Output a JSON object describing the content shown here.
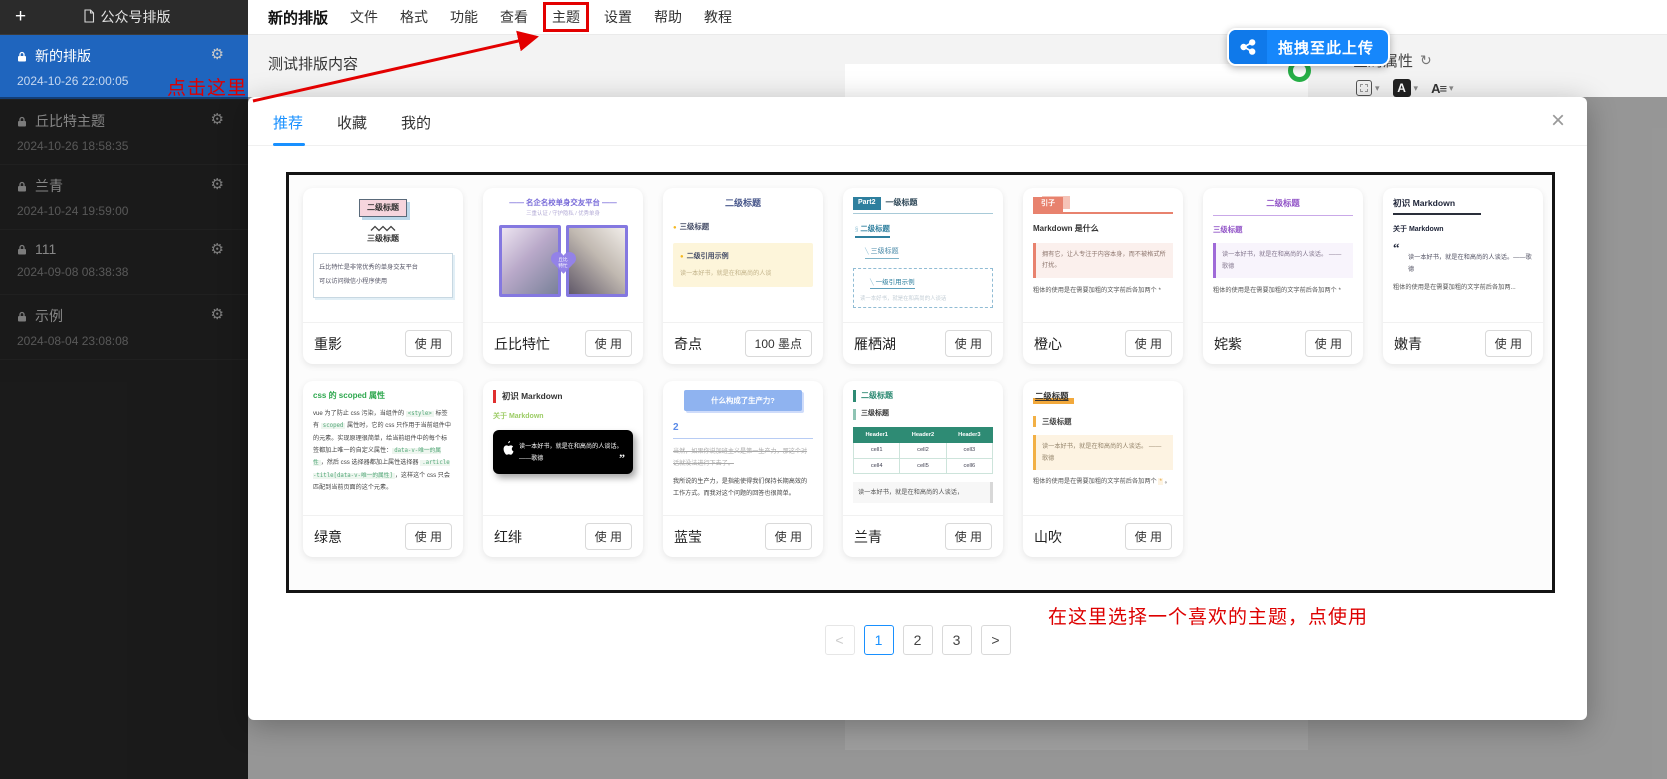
{
  "app": {
    "title": "公众号排版",
    "new_doc_button": "+",
    "accent_blue": "#1890ff",
    "sidebar_selected_blue": "#1f65be",
    "annotation_red": "#dd0000",
    "upload_blue": "#1687fb"
  },
  "sidebar": {
    "items": [
      {
        "title": "新的排版",
        "date": "2024-10-26 22:00:05",
        "selected": true
      },
      {
        "title": "丘比特主题",
        "date": "2024-10-26 18:58:35",
        "selected": false
      },
      {
        "title": "兰青",
        "date": "2024-10-24 19:59:00",
        "selected": false
      },
      {
        "title": "111",
        "date": "2024-09-08 08:38:38",
        "selected": false
      },
      {
        "title": "示例",
        "date": "2024-08-04 23:08:08",
        "selected": false
      }
    ]
  },
  "menu": {
    "items": [
      "新的排版",
      "文件",
      "格式",
      "功能",
      "查看",
      "主题",
      "设置",
      "帮助",
      "教程"
    ]
  },
  "editor": {
    "content": "测试排版内容",
    "preview_content": "测试排版内容"
  },
  "top_right": {
    "upload_label": "拖拽至此上传",
    "global_props_label": "全局属性",
    "refresh_icon": "↻",
    "font_icon_label": "A",
    "text_style_icon_label": "A≡",
    "chevron": "▾"
  },
  "annotations": {
    "click_here": "点击这里",
    "choose_theme": "在这里选择一个喜欢的主题，点使用"
  },
  "modal": {
    "tabs": [
      {
        "label": "推荐",
        "active": true
      },
      {
        "label": "收藏",
        "active": false
      },
      {
        "label": "我的",
        "active": false
      }
    ],
    "close": "×",
    "pagination": {
      "prev": "<",
      "pages": [
        "1",
        "2",
        "3"
      ],
      "next": ">",
      "active_page": "1"
    },
    "themes_row1": [
      {
        "name": "重影",
        "action": "使 用"
      },
      {
        "name": "丘比特忙",
        "action": "使 用"
      },
      {
        "name": "奇点",
        "action": "100 墨点"
      },
      {
        "name": "雁栖湖",
        "action": "使 用"
      },
      {
        "name": "橙心",
        "action": "使 用"
      },
      {
        "name": "姹紫",
        "action": "使 用"
      },
      {
        "name": "嫩青",
        "action": "使 用"
      }
    ],
    "themes_row2": [
      {
        "name": "绿意",
        "action": "使 用"
      },
      {
        "name": "红绯",
        "action": "使 用"
      },
      {
        "name": "蓝莹",
        "action": "使 用"
      },
      {
        "name": "兰青",
        "action": "使 用"
      },
      {
        "name": "山吹",
        "action": "使 用"
      }
    ],
    "previews": {
      "zhongying": {
        "h2": "二级标题",
        "h3": "三级标题",
        "line1": "丘比特忙是非常优秀的单身交友平台",
        "line2": "可以访问微信小程序使用"
      },
      "qiubite": {
        "title": "—— 名企名校单身交友平台 ——",
        "sub": "三重认证 / 守护隐私 / 优秀单身",
        "heart_line1": "丘比",
        "heart_line2": "特忙"
      },
      "qidian": {
        "h2": "二级标题",
        "h3": "三级标题",
        "quote_title": "二级引用示例",
        "quote_body": "读一本好书，就是在和高尚的人谈"
      },
      "yanqihu": {
        "part": "Part2",
        "h1": "一级标题",
        "h2": "二级标题",
        "h2_mark": "§",
        "h3": "三级标题",
        "diag": "╲",
        "quote": "一级引用示例",
        "tail": "读一本好书，就是在和高尚的人谈话"
      },
      "chengxin": {
        "tag": "引子",
        "h": "Markdown 是什么",
        "quote": "拥有它，让人专注于内容本身，而不被格式所打扰。",
        "body": "粗体的使用是在需要加粗的文字前后各加两个 *"
      },
      "chazi": {
        "h2": "二级标题",
        "h3": "三级标题",
        "quote": "读一本好书，就是在和高尚的人谈话。 ——歌德",
        "body": "粗体的使用是在需要加粗的文字前后各加两个 *"
      },
      "nenqing": {
        "h1": "初识 Markdown",
        "h2": "关于 Markdown",
        "quote_mark": "“",
        "quote": "读一本好书，就是在和高尚的人谈话。——歌德",
        "body": "粗体的使用是在需要加粗的文字前后各加两..."
      },
      "lvyi": {
        "title": "css 的 scoped 属性",
        "seg1": "vue 为了防止 css 污染，当组件的 ",
        "code1": "<style>",
        "seg2": " 标签有 ",
        "code2": "scoped",
        "seg3": " 属性时，它的 css 只作用于当前组件中的元素。实现原理很简单，给当前组件中的每个标签都加上唯一的自定义属性：",
        "code3": "data-v-唯一的属性",
        "seg4": "，然后 css 选择器都加上属性选择器 ",
        "code4": ".article-title[data-v-唯一的属性]",
        "seg5": "，这样这个 css 只会匹配到当前页面的这个元素。"
      },
      "hongfei": {
        "h1": "初识 Markdown",
        "h2": "关于 Markdown",
        "quote": "读一本好书，就是在和高尚的人谈话。 ——歌德",
        "quote_mark": "”"
      },
      "lanying": {
        "title": "什么构成了生产力?",
        "num": "2",
        "strike": "当然，如果你说加班主义是第一生产力，那这个对话就没法进行下去了。",
        "body": "我所说的生产力，是指能使得我们保持长期高效的工作方式。而我对这个问题的回答也很简单。"
      },
      "lanqing": {
        "h2": "二级标题",
        "h3": "三级标题",
        "headers": [
          "Header1",
          "Header2",
          "Header3"
        ],
        "cells": [
          "cell1",
          "cell2",
          "cell3",
          "cell4",
          "cell5",
          "cell6"
        ],
        "quote": "读一本好书，就是在和高尚的人谈话，"
      },
      "shanchui": {
        "h2": "二级标题",
        "h3": "三级标题",
        "quote": "读一本好书，就是在和高尚的人谈话。 ——歌德",
        "body1": "粗体的使用是在需要加粗的文字前后各加两个 ",
        "star": "*",
        "body2": " 。"
      }
    }
  }
}
